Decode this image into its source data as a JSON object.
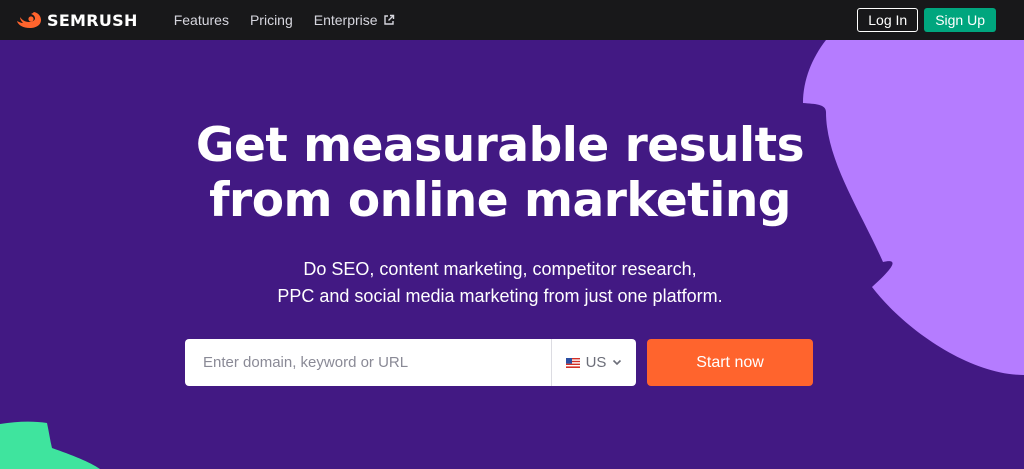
{
  "brand": {
    "name": "SEMRUSH",
    "accent_color": "#ff642d",
    "logo_icon": "semrush-fire-icon"
  },
  "nav": {
    "links": [
      {
        "label": "Features"
      },
      {
        "label": "Pricing"
      },
      {
        "label": "Enterprise",
        "icon": "external-link-icon"
      }
    ],
    "login_label": "Log In",
    "signup_label": "Sign Up"
  },
  "hero": {
    "title_line1": "Get measurable results",
    "title_line2": "from online marketing",
    "subtitle_line1": "Do SEO, content marketing, competitor research,",
    "subtitle_line2": "PPC and social media marketing from just one platform."
  },
  "search": {
    "placeholder": "Enter domain, keyword or URL",
    "value": "",
    "country": "US",
    "country_icon": "us-flag-icon",
    "dropdown_icon": "chevron-down-icon",
    "submit_label": "Start now"
  },
  "colors": {
    "background": "#421983",
    "nav_background": "#18181a",
    "signup_green": "#00a67e",
    "start_orange": "#ff642d",
    "blob_purple": "#b57cff",
    "blob_green": "#3fe49e"
  }
}
